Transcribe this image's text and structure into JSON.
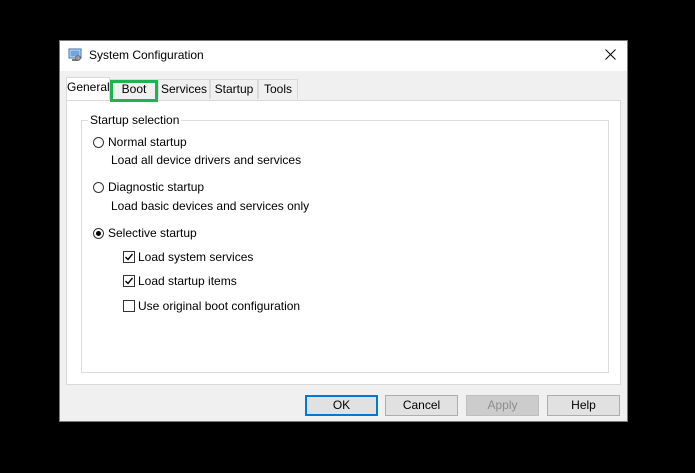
{
  "window": {
    "title": "System Configuration",
    "title_icon": "msconfig-app-icon",
    "close_icon": "close-icon"
  },
  "tabs": [
    {
      "label": "General",
      "active": true
    },
    {
      "label": "Boot",
      "highlighted": true
    },
    {
      "label": "Services"
    },
    {
      "label": "Startup"
    },
    {
      "label": "Tools"
    }
  ],
  "startup_selection": {
    "legend": "Startup selection",
    "normal": {
      "label": "Normal startup",
      "description": "Load all device drivers and services",
      "selected": false
    },
    "diagnostic": {
      "label": "Diagnostic startup",
      "description": "Load basic devices and services only",
      "selected": false
    },
    "selective": {
      "label": "Selective startup",
      "selected": true,
      "options": [
        {
          "label": "Load system services",
          "checked": true
        },
        {
          "label": "Load startup items",
          "checked": true
        },
        {
          "label": "Use original boot configuration",
          "checked": false
        }
      ]
    }
  },
  "buttons": {
    "ok": "OK",
    "cancel": "Cancel",
    "apply": "Apply",
    "help": "Help"
  },
  "colors": {
    "highlight": "#22b14c",
    "default_button_border": "#0078d7"
  }
}
